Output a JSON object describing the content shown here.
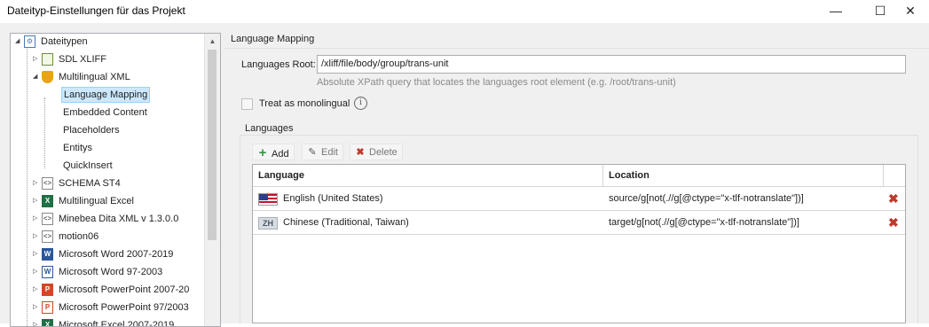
{
  "window": {
    "title": "Dateityp-Einstellungen für das Projekt",
    "controls": {
      "minimize": "—",
      "maximize": "☐",
      "close": "✕"
    }
  },
  "tree": {
    "items": [
      {
        "label": "Dateitypen",
        "icon": "filetypes-root-icon",
        "expander": "◢"
      },
      {
        "label": "SDL XLIFF",
        "icon": "xliff-file-icon",
        "expander": "▷"
      },
      {
        "label": "Multilingual XML",
        "icon": "multilingual-xml-icon",
        "expander": "◢"
      },
      {
        "label": "Language Mapping",
        "selected": true
      },
      {
        "label": "Embedded Content"
      },
      {
        "label": "Placeholders"
      },
      {
        "label": "Entitys"
      },
      {
        "label": "QuickInsert"
      },
      {
        "label": "SCHEMA ST4",
        "icon": "xml-file-icon",
        "expander": "▷"
      },
      {
        "label": "Multilingual Excel",
        "icon": "excel-icon",
        "expander": "▷"
      },
      {
        "label": "Minebea Dita XML v 1.3.0.0",
        "icon": "xml-file-icon",
        "expander": "▷"
      },
      {
        "label": "motion06",
        "icon": "xml-file-icon",
        "expander": "▷"
      },
      {
        "label": "Microsoft Word 2007-2019",
        "icon": "word-icon",
        "expander": "▷"
      },
      {
        "label": "Microsoft Word 97-2003",
        "icon": "word-icon",
        "expander": "▷"
      },
      {
        "label": "Microsoft PowerPoint 2007-20",
        "icon": "powerpoint-icon",
        "expander": "▷"
      },
      {
        "label": "Microsoft PowerPoint 97/2003",
        "icon": "powerpoint-icon",
        "expander": "▷"
      },
      {
        "label": "Microsoft Excel 2007-2019",
        "icon": "excel-icon",
        "expander": "▷"
      }
    ],
    "scroll_up": "▲"
  },
  "panel": {
    "section_title": "Language Mapping",
    "languages_root_label": "Languages Root:",
    "languages_root_value": "/xliff/file/body/group/trans-unit",
    "languages_root_hint": "Absolute XPath query that locates the languages root element (e.g. /root/trans-unit)",
    "monolingual_label": "Treat as monolingual",
    "info_glyph": "i",
    "languages_group_label": "Languages",
    "toolbar": {
      "add_label": "Add",
      "add_icon": "+",
      "edit_label": "Edit",
      "edit_icon": "✎",
      "delete_label": "Delete",
      "delete_icon": "✖"
    },
    "grid": {
      "columns": [
        "Language",
        "Location"
      ],
      "rows": [
        {
          "flag": "us-flag-icon",
          "language": "English (United States)",
          "location": "source/g[not(.//g[@ctype=\"x-tlf-notranslate\"])]",
          "delete_glyph": "✖"
        },
        {
          "flag": "zh-badge-icon",
          "flag_text": "ZH",
          "language": "Chinese (Traditional, Taiwan)",
          "location": "target/g[not(.//g[@ctype=\"x-tlf-notranslate\"])]",
          "delete_glyph": "✖"
        }
      ]
    }
  }
}
